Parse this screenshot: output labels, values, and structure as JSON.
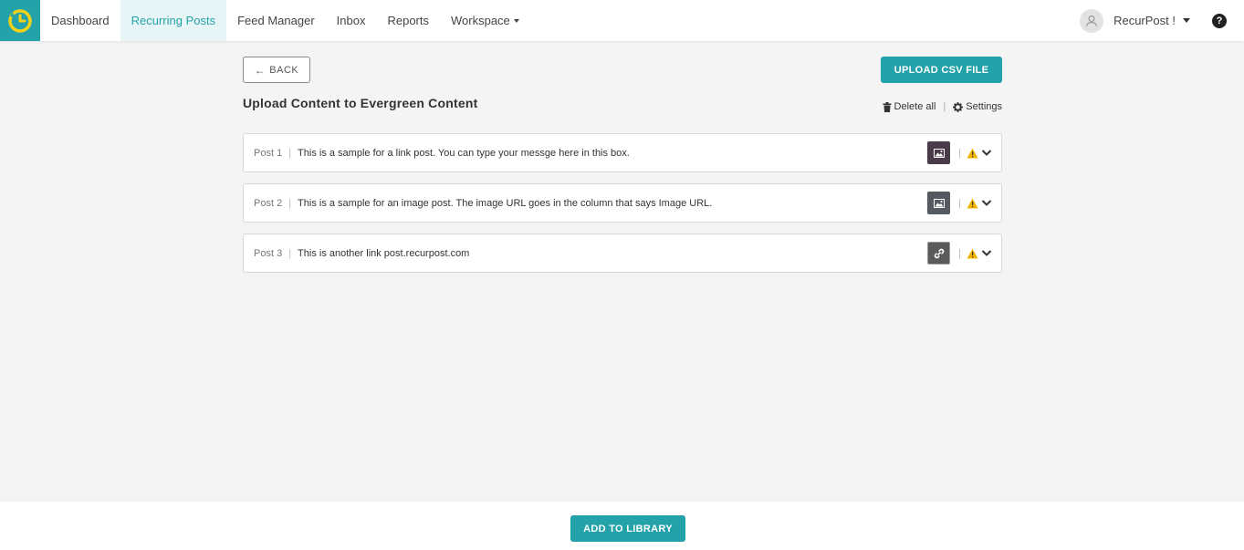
{
  "nav": {
    "logo_icon": "recurpost-clock-logo",
    "items": [
      {
        "label": "Dashboard"
      },
      {
        "label": "Recurring Posts"
      },
      {
        "label": "Feed Manager"
      },
      {
        "label": "Inbox"
      },
      {
        "label": "Reports"
      },
      {
        "label": "Workspace"
      }
    ],
    "active_item": "Recurring Posts",
    "user_name": "RecurPost !"
  },
  "toolbar": {
    "back_label": "BACK",
    "upload_label": "UPLOAD CSV FILE"
  },
  "page": {
    "title": "Upload Content to Evergreen Content",
    "delete_all_label": "Delete all",
    "settings_label": "Settings"
  },
  "posts": [
    {
      "label": "Post 1",
      "text": "This is a sample for a link post. You can type your messge here in this box.",
      "thumb_icon": "image-icon"
    },
    {
      "label": "Post 2",
      "text": "This is a sample for an image post. The image URL goes in the column that says Image URL.",
      "thumb_icon": "image-icon"
    },
    {
      "label": "Post 3",
      "text": "This is another link post.recurpost.com",
      "thumb_icon": "link-icon"
    }
  ],
  "footer": {
    "add_label": "ADD TO LIBRARY"
  },
  "colors": {
    "accent": "#23a3a9",
    "warning": "#f0b400",
    "background": "#f4f4f4"
  }
}
